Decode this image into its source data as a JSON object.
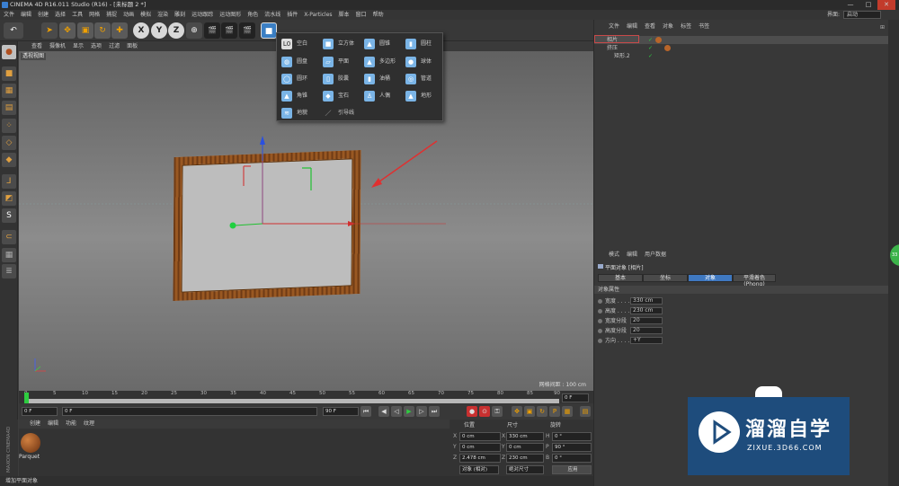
{
  "titlebar": {
    "title": "CINEMA 4D R16.011 Studio (R16) - [未标题 2 *]",
    "min": "—",
    "max": "□",
    "close": "✕"
  },
  "menubar": {
    "items": [
      "文件",
      "编辑",
      "创建",
      "选择",
      "工具",
      "网格",
      "捕捉",
      "动画",
      "模拟",
      "渲染",
      "雕刻",
      "运动跟踪",
      "运动图形",
      "角色",
      "流水线",
      "插件",
      "X-Particles",
      "脚本",
      "窗口",
      "帮助"
    ],
    "layout_label": "界面:",
    "layout_value": "启动"
  },
  "toolbar": {
    "undo": "↶",
    "x": "X",
    "y": "Y",
    "z": "Z",
    "w": "⊕"
  },
  "viewport": {
    "menu": [
      "查看",
      "摄像机",
      "显示",
      "选项",
      "过滤",
      "面板"
    ],
    "label": "透视视图",
    "grid": "网格间距 : 100 cm"
  },
  "dropdown": {
    "items": [
      {
        "label": "空白",
        "icon": "L0"
      },
      {
        "label": "立方体",
        "icon": "■"
      },
      {
        "label": "圆锥",
        "icon": "▲"
      },
      {
        "label": "圆柱",
        "icon": "▮"
      },
      {
        "label": "圆盘",
        "icon": "◍"
      },
      {
        "label": "平面",
        "icon": "▱"
      },
      {
        "label": "多边形",
        "icon": "▲"
      },
      {
        "label": "球体",
        "icon": "●"
      },
      {
        "label": "圆环",
        "icon": "◯"
      },
      {
        "label": "胶囊",
        "icon": "▯"
      },
      {
        "label": "油桶",
        "icon": "▮"
      },
      {
        "label": "管道",
        "icon": "◎"
      },
      {
        "label": "角锥",
        "icon": "▲"
      },
      {
        "label": "宝石",
        "icon": "◆"
      },
      {
        "label": "人偶",
        "icon": "♙"
      },
      {
        "label": "地形",
        "icon": "▲"
      },
      {
        "label": "地貌",
        "icon": "≋"
      },
      {
        "label": "引导线",
        "icon": "／"
      }
    ]
  },
  "timeline": {
    "ticks": [
      "0",
      "5",
      "10",
      "15",
      "20",
      "25",
      "30",
      "35",
      "40",
      "45",
      "50",
      "55",
      "60",
      "65",
      "70",
      "75",
      "80",
      "85",
      "90"
    ],
    "frame_end": "0 F"
  },
  "playback": {
    "start": "0 F",
    "cur": "0 F",
    "end": "90 F",
    "end2": "90 F"
  },
  "material": {
    "menu": [
      "创建",
      "编辑",
      "功能",
      "纹理"
    ],
    "name": "Parquet"
  },
  "brand_vert": "MAXON CINEMA4D",
  "coords": {
    "headers": [
      "位置",
      "尺寸",
      "旋转"
    ],
    "rows": [
      {
        "a": "X",
        "pos": "0 cm",
        "size": "330 cm",
        "r": "H",
        "rot": "0 °"
      },
      {
        "a": "Y",
        "pos": "0 cm",
        "size": "0 cm",
        "r": "P",
        "rot": "90 °"
      },
      {
        "a": "Z",
        "pos": "2.478 cm",
        "size": "230 cm",
        "r": "B",
        "rot": "0 °"
      }
    ],
    "mode": "对象 (相对)",
    "size_mode": "绝对尺寸",
    "apply": "应用"
  },
  "status": "增加平面对象",
  "objects": {
    "menu": [
      "文件",
      "编辑",
      "查看",
      "对象",
      "标签",
      "书签"
    ],
    "rows": [
      {
        "name": "相片"
      },
      {
        "name": "挤压"
      },
      {
        "name": "矩形.2"
      }
    ]
  },
  "attributes": {
    "menu": [
      "模式",
      "编辑",
      "用户数据"
    ],
    "title": "平面对象 [相片]",
    "tabs": [
      "基本",
      "坐标",
      "对象",
      "平滑着色(Phong)"
    ],
    "section": "对象属性",
    "props": [
      {
        "label": "宽度 . . . . .",
        "value": "330 cm"
      },
      {
        "label": "高度 . . . . .",
        "value": "230 cm"
      },
      {
        "label": "宽度分段",
        "value": "20"
      },
      {
        "label": "高度分段",
        "value": "20"
      },
      {
        "label": "方向 . . . . .",
        "value": "+Y"
      }
    ]
  },
  "brand": {
    "title": "溜溜自学",
    "sub": "ZIXUE.3D66.COM"
  },
  "badge": "33"
}
